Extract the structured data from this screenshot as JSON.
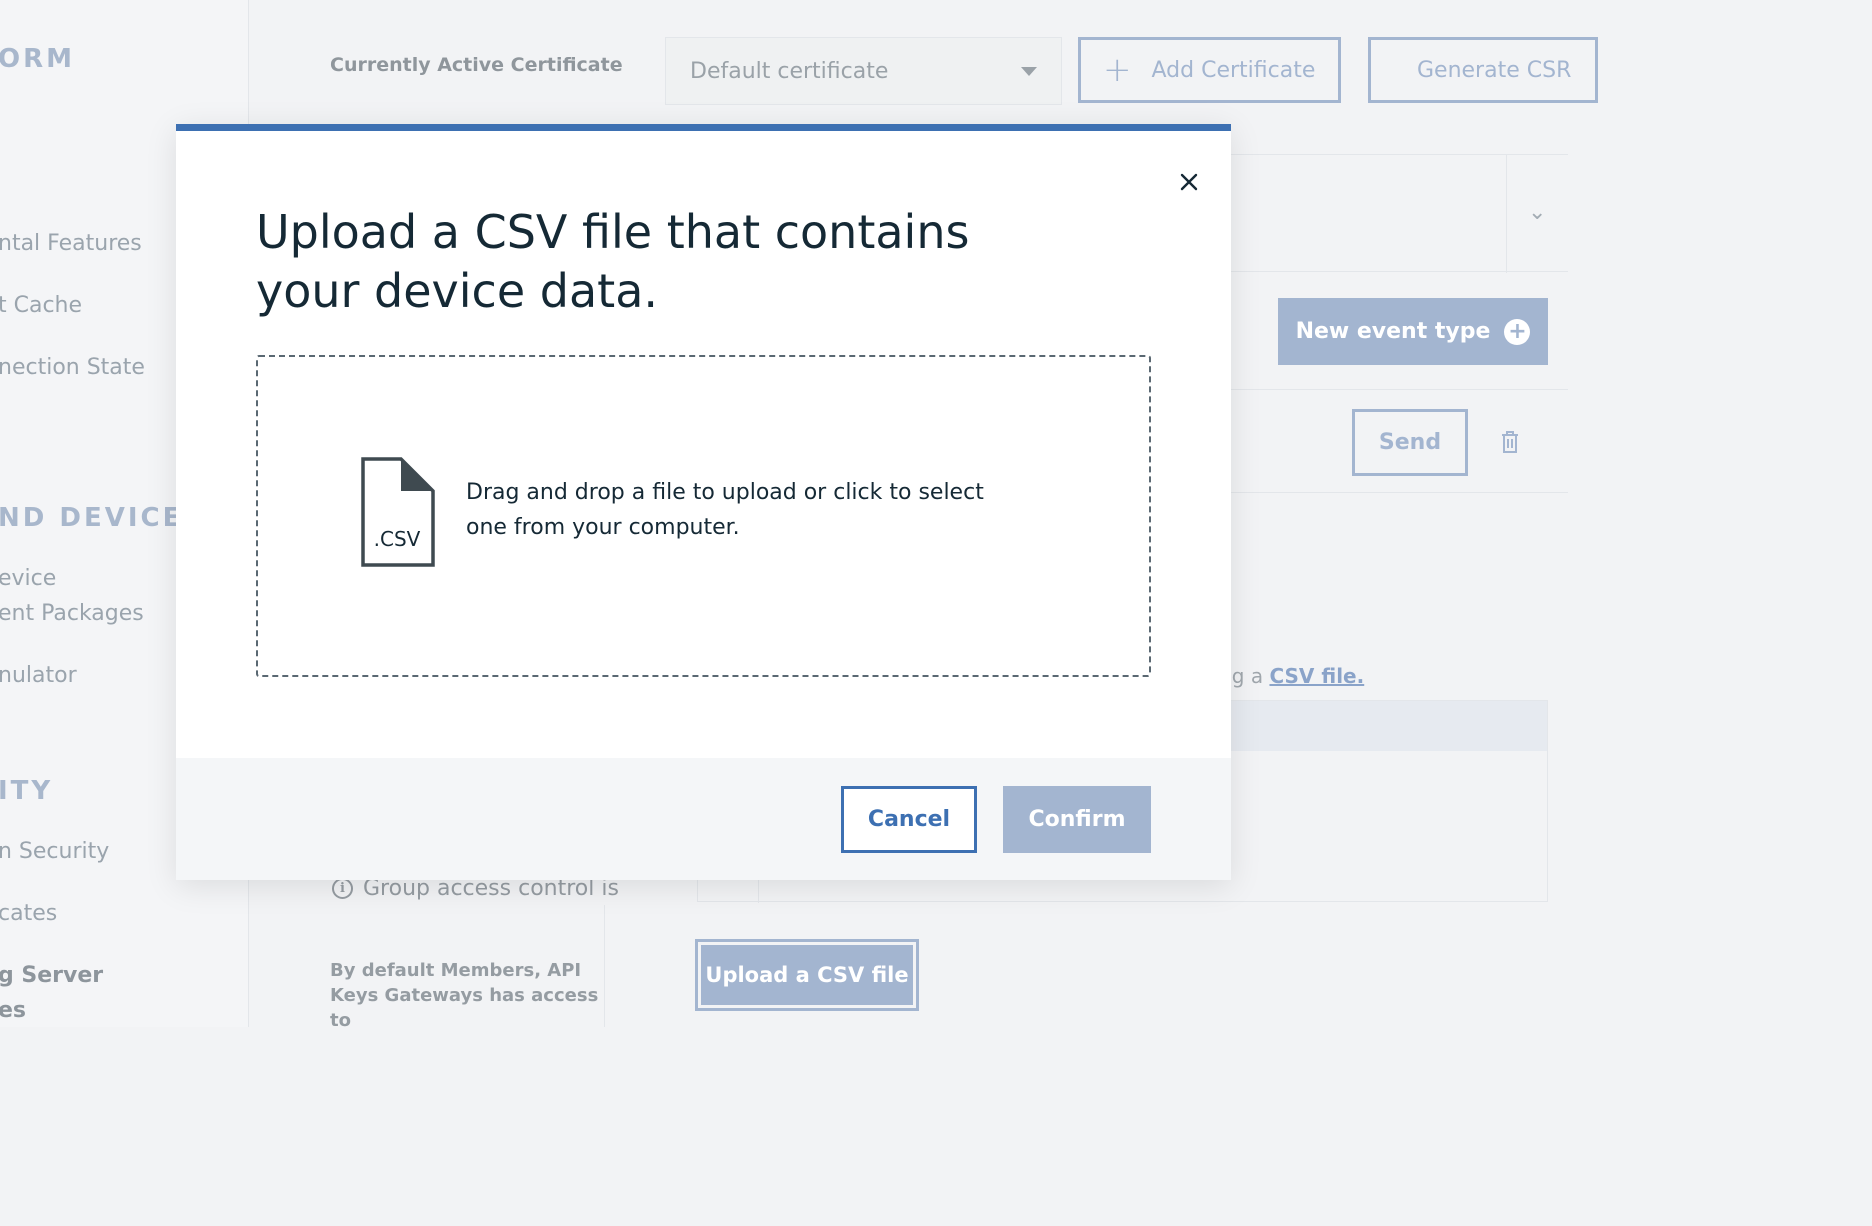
{
  "sidebar": {
    "section_platform": "ORM",
    "items_platform": [
      "ntal Features",
      "t Cache",
      "nection State"
    ],
    "section_devices": "ND DEVICES",
    "items_devices": [
      "evice",
      "ent Packages",
      "nulator"
    ],
    "section_security": "ITY",
    "items_security": [
      "n Security",
      "cates",
      "g Server",
      "es"
    ]
  },
  "certificates": {
    "label": "Currently Active Certificate",
    "selected": "Default certificate",
    "add_button": "Add Certificate",
    "generate_button": "Generate CSR"
  },
  "events": {
    "new_event_button": "New event type",
    "send_button": "Send"
  },
  "csv_hint": {
    "prefix": "ling a",
    "link": "CSV file."
  },
  "group_access": {
    "info_text": "Group access control is",
    "description": "By default Members, API Keys Gateways has access to"
  },
  "upload_button": "Upload a CSV file",
  "modal": {
    "title": "Upload a CSV file that contains your device data.",
    "file_icon_label": ".CSV",
    "dropzone_text": "Drag and drop a file to upload or click to select one from your computer.",
    "cancel_label": "Cancel",
    "confirm_label": "Confirm",
    "accent_color": "#3d70b2",
    "disabled_color": "#a3b5d0"
  },
  "icons": [
    "close-icon",
    "file-csv-icon",
    "plus-icon",
    "plus-circle-icon",
    "trash-icon",
    "info-icon",
    "chevron-down-icon",
    "caret-down-icon"
  ]
}
